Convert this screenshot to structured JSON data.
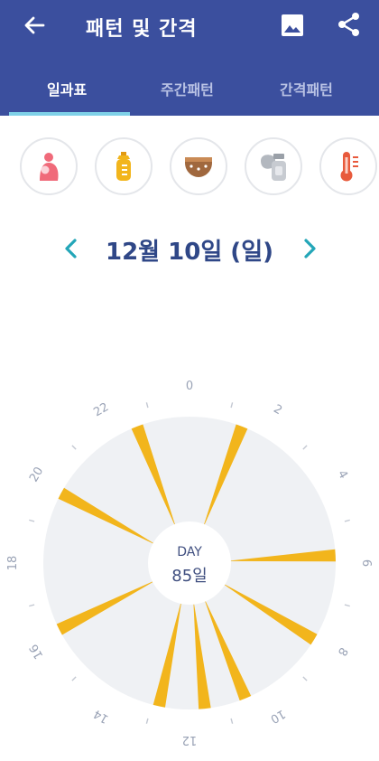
{
  "header": {
    "title": "패턴 및 간격",
    "back_icon": "arrow-left-icon",
    "image_icon": "image-icon",
    "share_icon": "share-icon"
  },
  "tabs": [
    {
      "label": "일과표",
      "active": true
    },
    {
      "label": "주간패턴",
      "active": false
    },
    {
      "label": "간격패턴",
      "active": false
    }
  ],
  "activities": [
    {
      "name": "breastfeeding",
      "icon": "breastfeeding-icon",
      "color": "#f06a7a"
    },
    {
      "name": "bottle",
      "icon": "bottle-icon",
      "color": "#f2b51c"
    },
    {
      "name": "diaper",
      "icon": "diaper-icon",
      "color": "#a0683e"
    },
    {
      "name": "breast-pump",
      "icon": "breast-pump-icon",
      "color": "#9aa0a8"
    },
    {
      "name": "temperature",
      "icon": "thermometer-icon",
      "color": "#e85a3c"
    }
  ],
  "date": {
    "label": "12월 10일 (일)"
  },
  "clock": {
    "hour_labels": [
      "0",
      "2",
      "4",
      "6",
      "8",
      "10",
      "12",
      "14",
      "16",
      "18",
      "20",
      "22"
    ],
    "center_label": "DAY",
    "center_value": "85일",
    "feed_color": "#f2b51c",
    "feeding_times_hours": [
      1.4,
      5.8,
      8.1,
      10.5,
      11.6,
      12.8,
      16.2,
      19.9,
      22.6
    ]
  },
  "colors": {
    "appbar": "#3b4f9e",
    "accent": "#2f4787",
    "chevron": "#23a6b8"
  }
}
